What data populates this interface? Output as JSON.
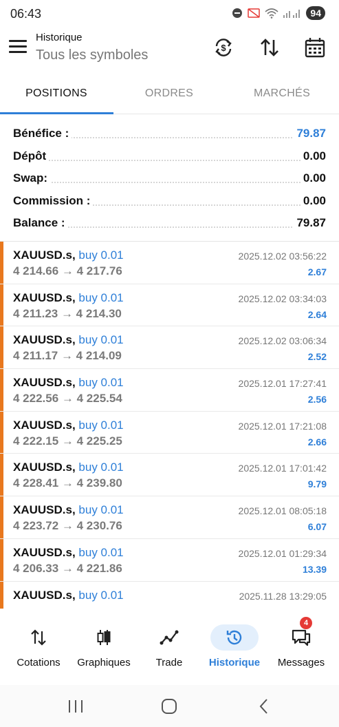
{
  "status_bar": {
    "time": "06:43",
    "battery": "94"
  },
  "header": {
    "title": "Historique",
    "subtitle": "Tous les symboles"
  },
  "tabs": [
    {
      "label": "POSITIONS",
      "active": true
    },
    {
      "label": "ORDRES",
      "active": false
    },
    {
      "label": "MARCHÉS",
      "active": false
    }
  ],
  "summary": [
    {
      "label": "Bénéfice :",
      "value": "79.87",
      "highlight": true
    },
    {
      "label": "Dépôt",
      "value": "0.00",
      "highlight": false
    },
    {
      "label": "Swap:",
      "value": "0.00",
      "highlight": false
    },
    {
      "label": "Commission :",
      "value": "0.00",
      "highlight": false
    },
    {
      "label": "Balance :",
      "value": "79.87",
      "highlight": false
    }
  ],
  "trades": [
    {
      "symbol": "XAUUSD.s,",
      "side": "buy 0.01",
      "prices": "4 214.66 → 4 217.76",
      "time": "2025.12.02 03:56:22",
      "profit": "2.67"
    },
    {
      "symbol": "XAUUSD.s,",
      "side": "buy 0.01",
      "prices": "4 211.23 → 4 214.30",
      "time": "2025.12.02 03:34:03",
      "profit": "2.64"
    },
    {
      "symbol": "XAUUSD.s,",
      "side": "buy 0.01",
      "prices": "4 211.17 → 4 214.09",
      "time": "2025.12.02 03:06:34",
      "profit": "2.52"
    },
    {
      "symbol": "XAUUSD.s,",
      "side": "buy 0.01",
      "prices": "4 222.56 → 4 225.54",
      "time": "2025.12.01 17:27:41",
      "profit": "2.56"
    },
    {
      "symbol": "XAUUSD.s,",
      "side": "buy 0.01",
      "prices": "4 222.15 → 4 225.25",
      "time": "2025.12.01 17:21:08",
      "profit": "2.66"
    },
    {
      "symbol": "XAUUSD.s,",
      "side": "buy 0.01",
      "prices": "4 228.41 → 4 239.80",
      "time": "2025.12.01 17:01:42",
      "profit": "9.79"
    },
    {
      "symbol": "XAUUSD.s,",
      "side": "buy 0.01",
      "prices": "4 223.72 → 4 230.76",
      "time": "2025.12.01 08:05:18",
      "profit": "6.07"
    },
    {
      "symbol": "XAUUSD.s,",
      "side": "buy 0.01",
      "prices": "4 206.33 → 4 221.86",
      "time": "2025.12.01 01:29:34",
      "profit": "13.39"
    },
    {
      "symbol": "XAUUSD.s,",
      "side": "buy 0.01",
      "prices": "",
      "time": "2025.11.28 13:29:05",
      "profit": ""
    }
  ],
  "bottom_nav": [
    {
      "label": "Cotations",
      "icon": "quotes-arrows-icon",
      "active": false
    },
    {
      "label": "Graphiques",
      "icon": "candlestick-chart-icon",
      "active": false
    },
    {
      "label": "Trade",
      "icon": "trade-line-icon",
      "active": false
    },
    {
      "label": "Historique",
      "icon": "history-clock-icon",
      "active": true
    },
    {
      "label": "Messages",
      "icon": "messages-chat-icon",
      "active": false,
      "badge": "4"
    }
  ],
  "colors": {
    "accent_blue": "#2e7fd8",
    "trade_accent": "#e8781e",
    "badge_red": "#e53935"
  }
}
